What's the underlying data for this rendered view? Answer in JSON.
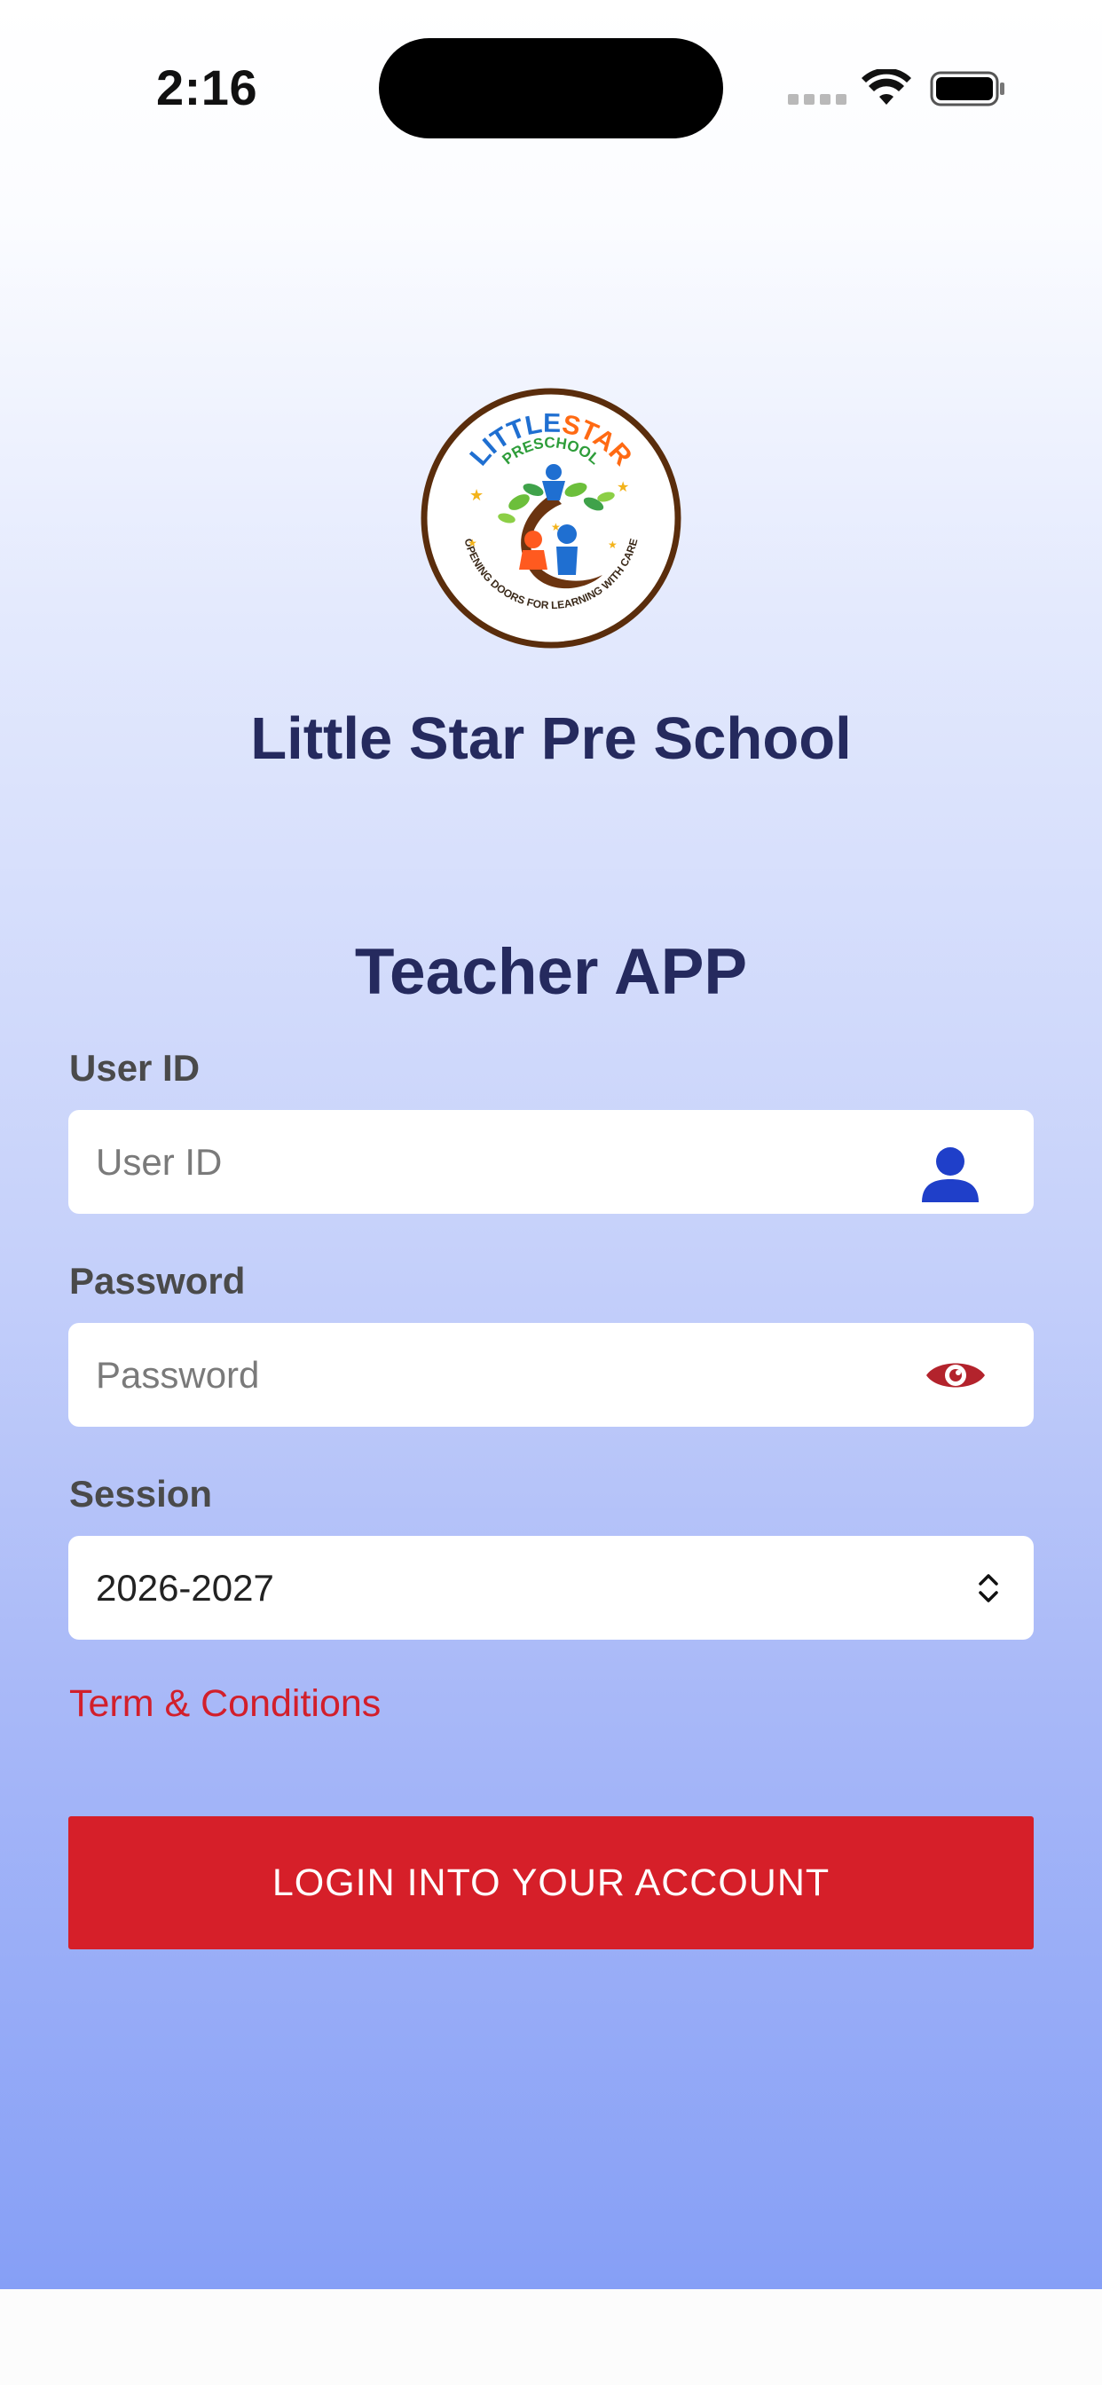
{
  "status_bar": {
    "time": "2:16"
  },
  "school": {
    "name": "Little Star Pre School",
    "logo": {
      "line1_a": "LITTLE",
      "line1_b": "STAR",
      "line2": "PRESCHOOL",
      "tagline": "OPENING DOORS FOR LEARNING WITH CARE"
    }
  },
  "app_title": "Teacher APP",
  "form": {
    "user_id": {
      "label": "User ID",
      "placeholder": "User ID",
      "value": ""
    },
    "password": {
      "label": "Password",
      "placeholder": "Password",
      "value": ""
    },
    "session": {
      "label": "Session",
      "selected": "2026-2027"
    },
    "terms_link": "Term & Conditions",
    "login_button": "LOGIN INTO YOUR ACCOUNT"
  },
  "icons": {
    "user": "person-icon",
    "password_toggle": "eye-icon",
    "session_select": "chevron-up-down-icon"
  },
  "colors": {
    "primary_text": "#252a5e",
    "accent_red": "#d61f29",
    "icon_blue": "#1f3fc9",
    "eye_red": "#b3232c"
  }
}
